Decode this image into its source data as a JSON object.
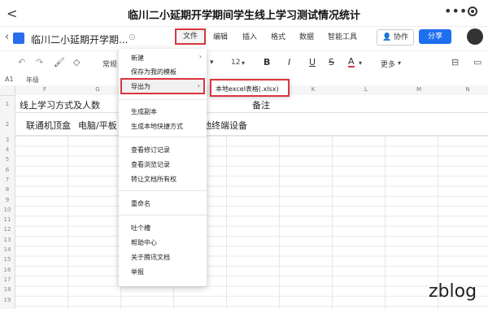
{
  "header": {
    "back_glyph": "<",
    "title": "临川二小延期开学期间学生线上学习测试情况统计",
    "more_glyph": "•••"
  },
  "appbar": {
    "doc_title": "临川二小延期开学期...",
    "tabs": [
      "文件",
      "编辑",
      "插入",
      "格式",
      "数据",
      "智能工具"
    ],
    "collab_label": "协作",
    "share_label": "分享"
  },
  "toolbar": {
    "style_label": "常规",
    "font_size": "12",
    "more_label": "更多"
  },
  "formula_bar": {
    "cell_ref": "A1",
    "content": "年级"
  },
  "columns": [
    "F",
    "G",
    "H",
    "I",
    "J",
    "K",
    "L",
    "M",
    "N"
  ],
  "rows": [
    "1",
    "2",
    "3",
    "4",
    "5",
    "6",
    "7",
    "8",
    "9",
    "10",
    "11",
    "12",
    "13",
    "14",
    "15",
    "16",
    "17",
    "18",
    "19"
  ],
  "sheet": {
    "row1_left": "线上学习方式及人数",
    "row1_right": "备注",
    "row2_cells": [
      "联通机顶盒",
      "电脑/平板",
      "其他终端设备"
    ]
  },
  "file_menu": {
    "items": [
      {
        "label": "新建",
        "arrow": "›"
      },
      {
        "label": "保存为我的模板"
      },
      {
        "label": "导出为",
        "arrow": "›"
      },
      {
        "label": "生成副本"
      },
      {
        "label": "生成本地快捷方式"
      },
      {
        "label": "查看修订记录"
      },
      {
        "label": "查看浏览记录"
      },
      {
        "label": "转让文档所有权"
      },
      {
        "label": "重命名"
      },
      {
        "label": "吐个槽"
      },
      {
        "label": "帮助中心"
      },
      {
        "label": "关于腾讯文档"
      },
      {
        "label": "举报"
      }
    ],
    "export_submenu": "本地excel表格(.xlsx)"
  },
  "watermark": "zblog",
  "colors": {
    "highlight_red": "#d9363e",
    "share_blue": "#1e6ff0"
  }
}
